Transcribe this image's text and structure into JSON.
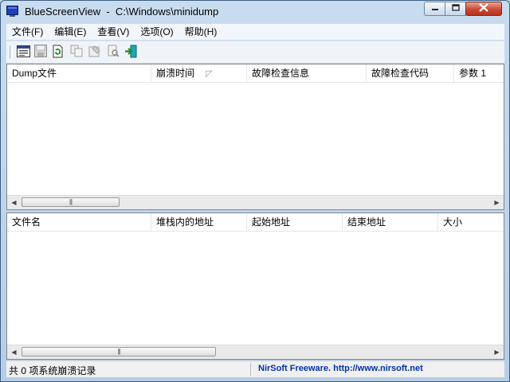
{
  "window": {
    "title": "BlueScreenView  -  C:\\Windows\\minidump",
    "icon": "bluescreen-app-icon",
    "buttons": {
      "minimize": "minimize-icon",
      "maximize": "maximize-icon",
      "close": "close-icon"
    }
  },
  "menu": {
    "items": [
      {
        "label": "文件(F)"
      },
      {
        "label": "编辑(E)"
      },
      {
        "label": "查看(V)"
      },
      {
        "label": "选项(O)"
      },
      {
        "label": "帮助(H)"
      }
    ]
  },
  "toolbar": {
    "buttons": [
      {
        "icon": "html-report-icon",
        "enabled": true
      },
      {
        "icon": "save-icon",
        "enabled": false
      },
      {
        "icon": "refresh-icon",
        "enabled": true
      },
      {
        "icon": "copy-icon",
        "enabled": false
      },
      {
        "icon": "properties-icon",
        "enabled": false
      },
      {
        "icon": "find-icon",
        "enabled": false
      },
      {
        "icon": "exit-icon",
        "enabled": true
      }
    ]
  },
  "top_pane": {
    "columns": [
      "Dump文件",
      "崩溃时间",
      "故障检查信息",
      "故障检查代码",
      "参数 1"
    ],
    "sorted_column": "崩溃时间",
    "rows": []
  },
  "bottom_pane": {
    "columns": [
      "文件名",
      "堆栈内的地址",
      "起始地址",
      "结束地址",
      "大小"
    ],
    "rows": []
  },
  "statusbar": {
    "count_text": "共 0 项系统崩溃记录",
    "credit_text": "NirSoft Freeware.  http://www.nirsoft.net"
  },
  "colors": {
    "title_bar": "#c9dcef",
    "close_button": "#c94a33",
    "credit_link": "#0033aa"
  }
}
